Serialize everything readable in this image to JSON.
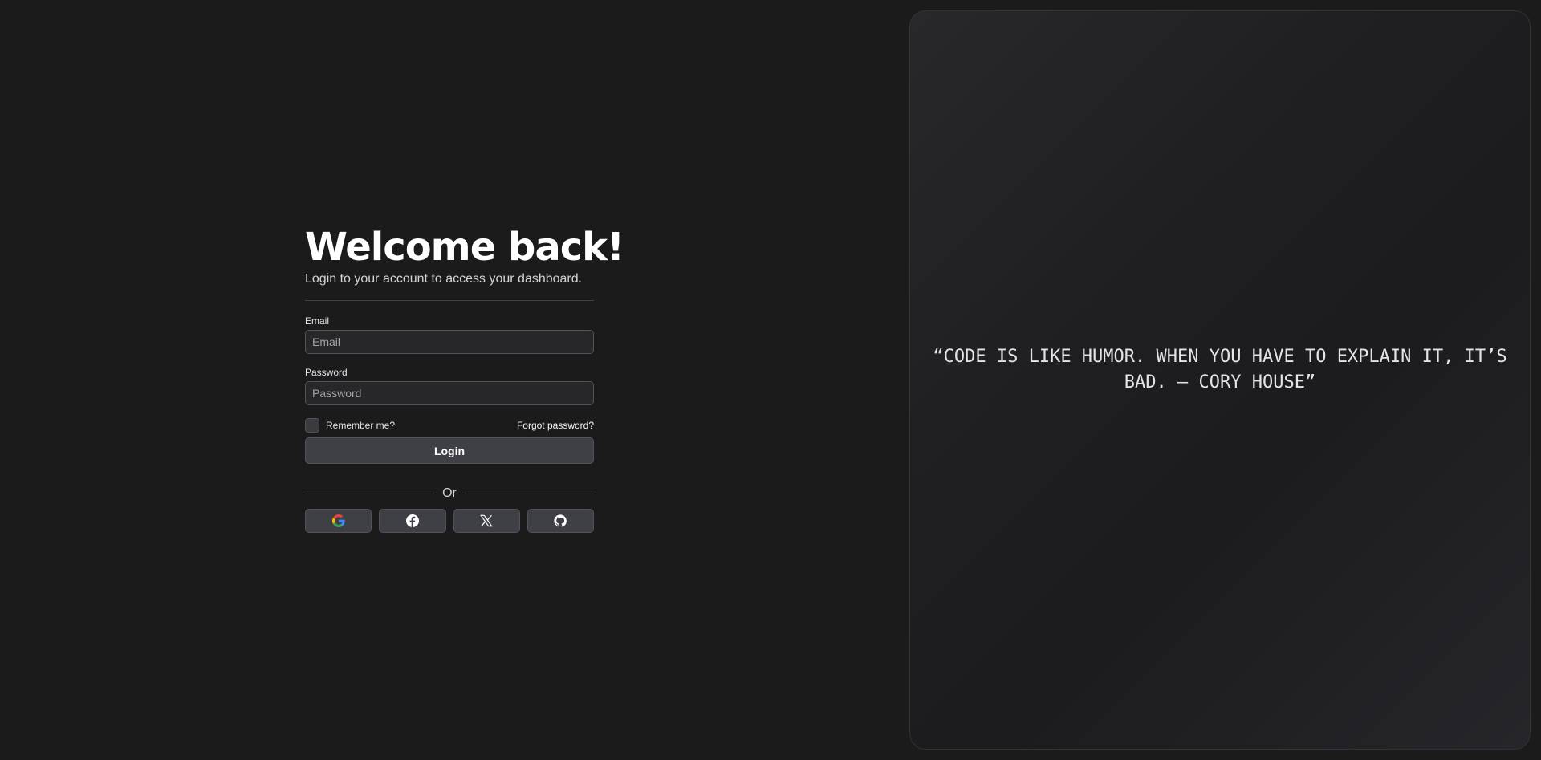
{
  "login": {
    "title": "Welcome back!",
    "subtitle": "Login to your account to access your dashboard.",
    "email": {
      "label": "Email",
      "placeholder": "Email",
      "value": ""
    },
    "password": {
      "label": "Password",
      "placeholder": "Password",
      "value": ""
    },
    "remember_label": "Remember me?",
    "remember_checked": false,
    "forgot_label": "Forgot password?",
    "submit_label": "Login",
    "or_label": "Or",
    "social_buttons": [
      {
        "icon": "google-icon"
      },
      {
        "icon": "facebook-icon"
      },
      {
        "icon": "x-icon"
      },
      {
        "icon": "github-icon"
      }
    ]
  },
  "quote": {
    "text": "“CODE IS LIKE HUMOR. WHEN YOU HAVE TO EXPLAIN IT, IT’S BAD. – CORY HOUSE”"
  },
  "colors": {
    "background": "#1b1b1c",
    "panel_border": "#52525b",
    "button_fill": "#3f3f46",
    "text": "#f4f4f5"
  }
}
